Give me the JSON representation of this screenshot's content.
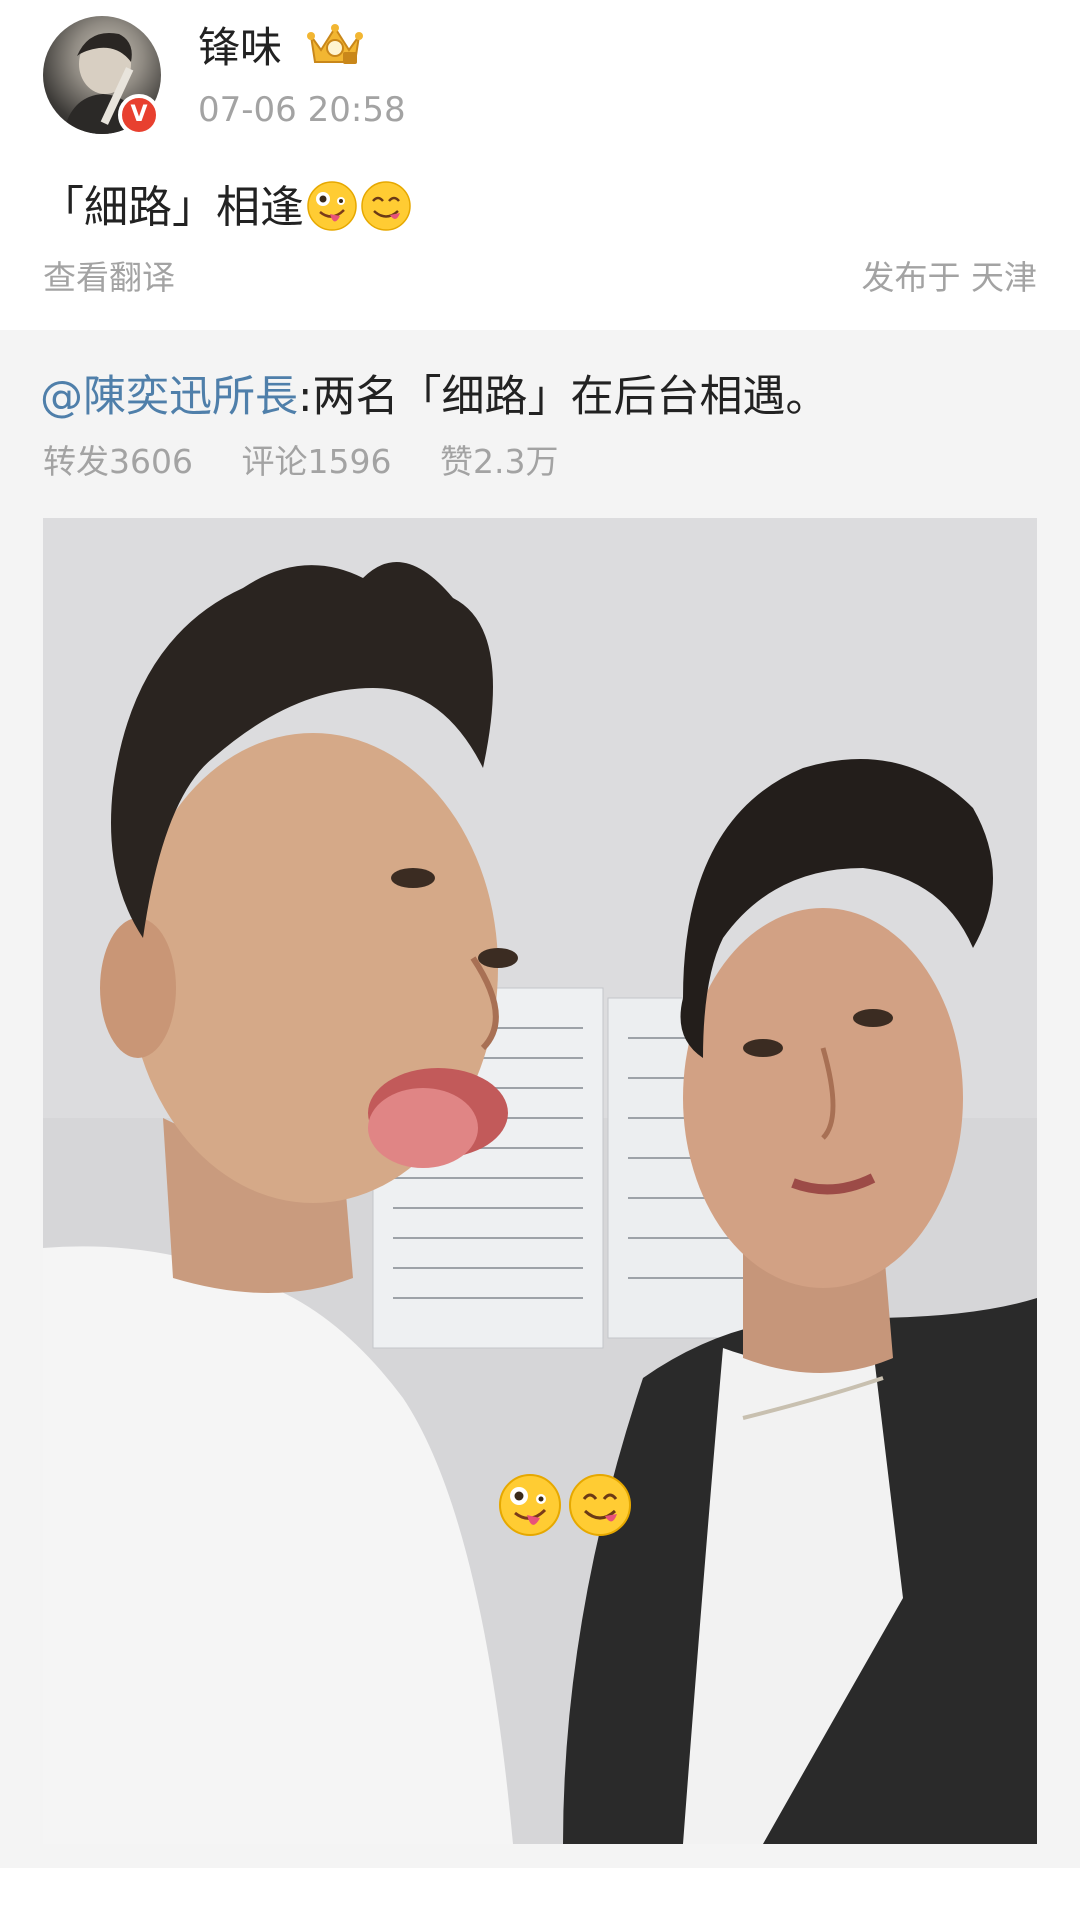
{
  "post": {
    "author": {
      "name": "锋味",
      "avatar_icon": "avatar-photo",
      "verified_badge": "V",
      "crown_icon": "crown-icon"
    },
    "timestamp": "07-06 20:58",
    "text": "「細路」相逢",
    "text_emojis": [
      "zany-face-emoji",
      "face-savoring-food-emoji"
    ],
    "translate_label": "查看翻译",
    "location_label": "发布于 天津"
  },
  "repost": {
    "mention": "@陳奕迅所長",
    "text": ":两名「细路」在后台相遇。",
    "stats": {
      "reposts": "转发3606",
      "comments": "评论1596",
      "likes": "赞2.3万"
    },
    "photo": {
      "description_icon": "selfie-photo",
      "overlay_emojis": [
        "zany-face-emoji",
        "face-savoring-food-emoji"
      ]
    }
  },
  "colors": {
    "mention": "#4f7faa",
    "meta_gray": "#a3a3a3",
    "background": "#f4f4f4",
    "verified_red": "#e8402f"
  }
}
